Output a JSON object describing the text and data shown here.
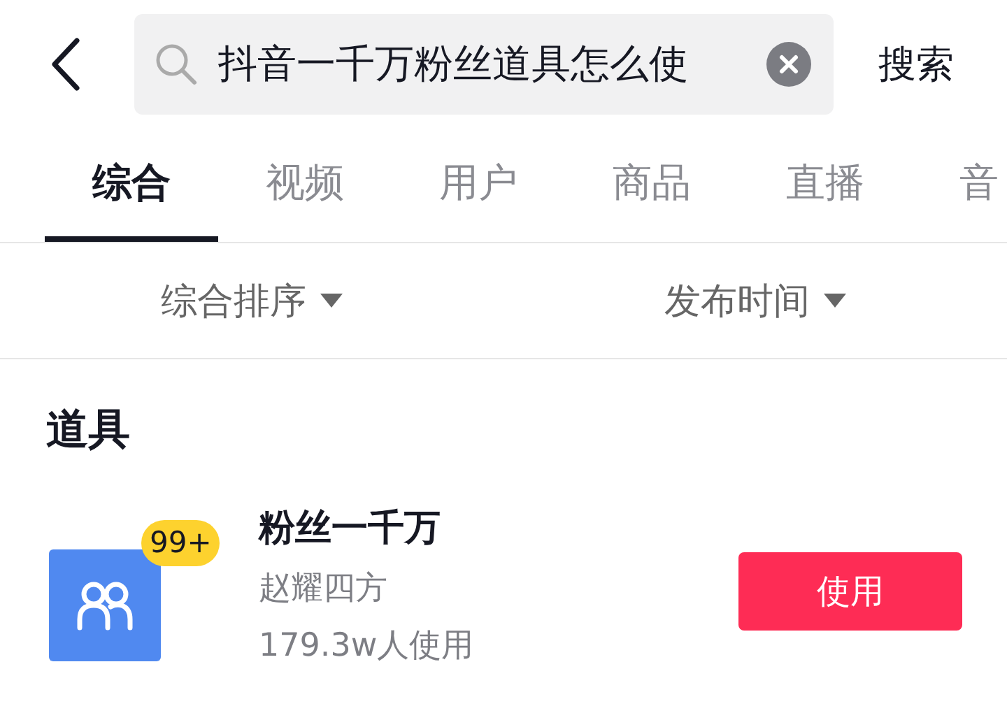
{
  "search": {
    "value": "抖音一千万粉丝道具怎么使"
  },
  "search_button": "搜索",
  "tabs": [
    {
      "label": "综合",
      "selected": true
    },
    {
      "label": "视频",
      "selected": false
    },
    {
      "label": "用户",
      "selected": false
    },
    {
      "label": "商品",
      "selected": false
    },
    {
      "label": "直播",
      "selected": false
    },
    {
      "label": "音",
      "selected": false
    }
  ],
  "sort_options": [
    {
      "label": "综合排序"
    },
    {
      "label": "发布时间"
    }
  ],
  "section_title": "道具",
  "props": [
    {
      "name": "粉丝一千万",
      "author": "赵耀四方",
      "usage": "179.3w人使用",
      "badge": "99+",
      "action": "使用"
    }
  ]
}
